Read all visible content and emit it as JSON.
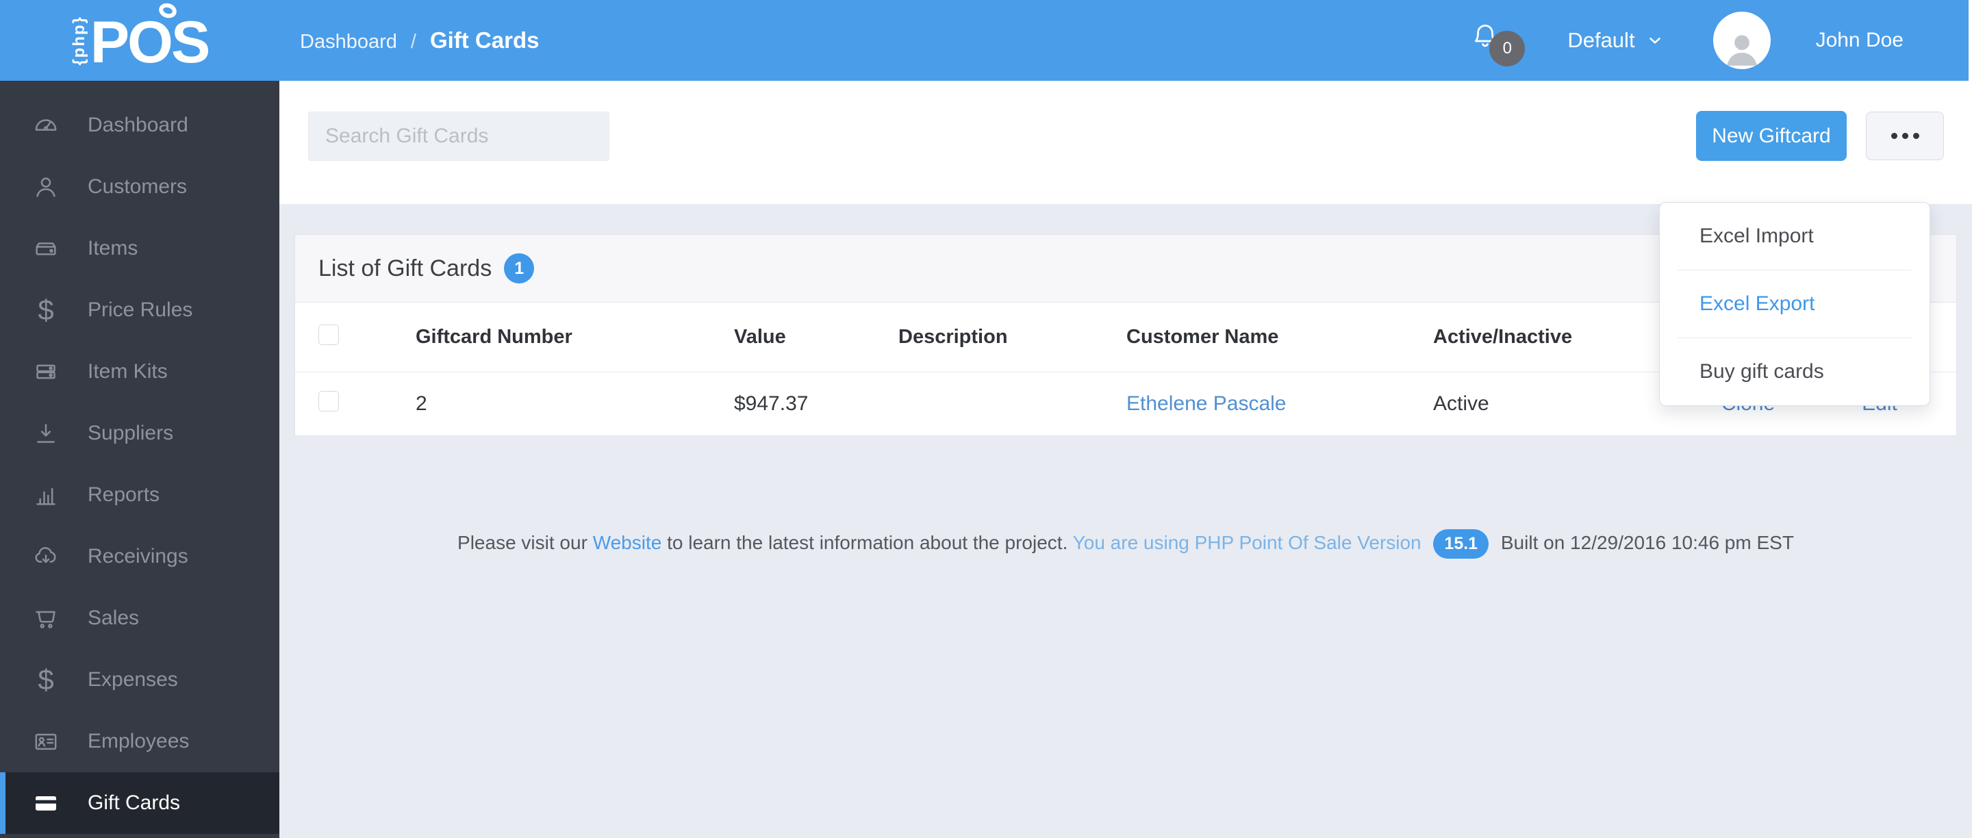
{
  "colors": {
    "accent_blue": "#4a9de9",
    "badge_blue": "#3f98e8",
    "sidebar_bg": "#353a44",
    "sidebar_active_bg": "#22262e",
    "page_bg": "#e8ebf2",
    "link_blue": "#4a90d8"
  },
  "header": {
    "logo": {
      "rotated_text": "{php}",
      "main_text": "POS"
    },
    "breadcrumb": {
      "parent": "Dashboard",
      "separator": "/",
      "current": "Gift Cards"
    },
    "notifications": {
      "icon": "bell-icon",
      "count": "0"
    },
    "register_selector": {
      "label": "Default",
      "icon": "chevron-down-icon"
    },
    "user": {
      "name": "John Doe",
      "avatar_icon": "person-silhouette"
    }
  },
  "sidebar": {
    "items": [
      {
        "label": "Dashboard",
        "icon": "gauge-icon",
        "active": false
      },
      {
        "label": "Customers",
        "icon": "person-icon",
        "active": false
      },
      {
        "label": "Items",
        "icon": "box-icon",
        "active": false
      },
      {
        "label": "Price Rules",
        "icon": "dollar-icon",
        "active": false
      },
      {
        "label": "Item Kits",
        "icon": "stacked-boxes-icon",
        "active": false
      },
      {
        "label": "Suppliers",
        "icon": "download-icon",
        "active": false
      },
      {
        "label": "Reports",
        "icon": "bar-chart-icon",
        "active": false
      },
      {
        "label": "Receivings",
        "icon": "cloud-download-icon",
        "active": false
      },
      {
        "label": "Sales",
        "icon": "cart-icon",
        "active": false
      },
      {
        "label": "Expenses",
        "icon": "dollar-icon",
        "active": false
      },
      {
        "label": "Employees",
        "icon": "id-card-icon",
        "active": false
      },
      {
        "label": "Gift Cards",
        "icon": "credit-card-icon",
        "active": true
      }
    ]
  },
  "toolbar": {
    "search_placeholder": "Search Gift Cards",
    "search_value": "",
    "new_giftcard_label": "New Giftcard",
    "more_options_icon": "ellipsis-icon"
  },
  "actions_menu": {
    "items": [
      {
        "label": "Excel Import",
        "highlighted": false
      },
      {
        "label": "Excel Export",
        "highlighted": true
      },
      {
        "label": "Buy gift cards",
        "highlighted": false
      }
    ]
  },
  "panel": {
    "title": "List of Gift Cards",
    "count_badge": "1",
    "table": {
      "columns": [
        "",
        "Giftcard Number",
        "Value",
        "Description",
        "Customer Name",
        "Active/Inactive",
        "",
        ""
      ],
      "rows": [
        {
          "giftcard_number": "2",
          "value": "$947.37",
          "description": "",
          "customer_name": "Ethelene Pascale",
          "status": "Active",
          "clone_label": "Clone",
          "edit_label": "Edit"
        }
      ]
    }
  },
  "footer": {
    "intro": "Please visit our",
    "website_link": "Website",
    "after_link": "to learn the latest information about the project.",
    "version_text": "You are using PHP Point Of Sale Version",
    "version_badge": "15.1",
    "built_text": "Built on 12/29/2016 10:46 pm EST"
  }
}
